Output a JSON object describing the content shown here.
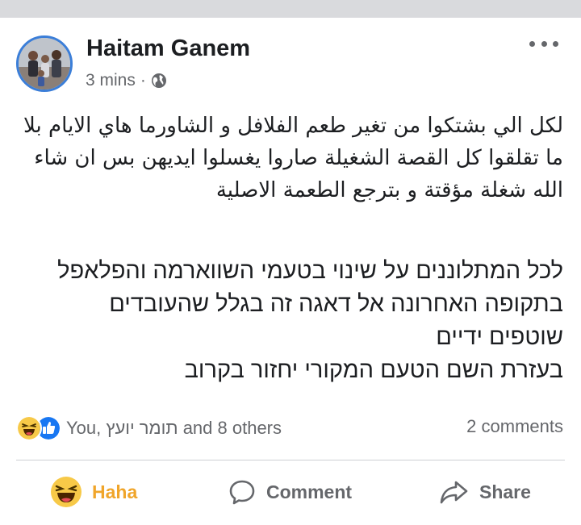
{
  "post": {
    "author": "Haitam Ganem",
    "time": "3 mins",
    "separator": "·",
    "privacy_icon": "globe-icon",
    "more_icon": "more-options-icon",
    "text_arabic": [
      "لكل الي بشتكوا من تغير طعم الفلافل و الشاورما هاي الايام بلا",
      "ما تقلقوا كل القصة الشغيلة صاروا يغسلوا ايديهن بس ان شاء",
      "الله شغلة مؤقتة و بترجع الطعمة الاصلية"
    ],
    "text_hebrew": [
      "לכל המתלוננים על שינוי בטעמי השווארמה והפלאפל",
      "בתקופה האחרונה אל דאגה זה בגלל שהעובדים",
      "שוטפים ידיים",
      "בעזרת השם הטעם המקורי יחזור בקרוב"
    ]
  },
  "reactions": {
    "icons": [
      "haha-reaction-icon",
      "like-reaction-icon"
    ],
    "summary": "You, תומר יועץ and 8 others",
    "comments_count": "2 comments"
  },
  "actions": {
    "haha_label": "Haha",
    "comment_label": "Comment",
    "share_label": "Share"
  },
  "colors": {
    "haha_active": "#f0a52a",
    "secondary_text": "#65676b",
    "like_blue": "#1877f2",
    "avatar_ring": "#3b7ed8"
  }
}
